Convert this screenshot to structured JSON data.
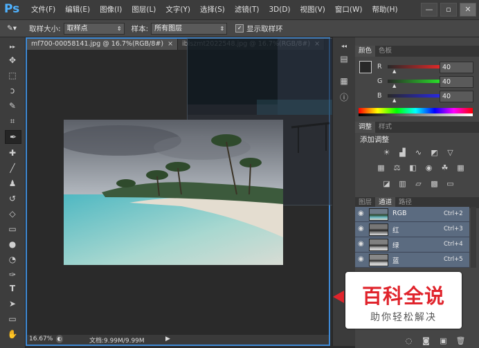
{
  "app": {
    "logo": "Ps"
  },
  "menu": [
    "文件(F)",
    "编辑(E)",
    "图像(I)",
    "图层(L)",
    "文字(Y)",
    "选择(S)",
    "滤镜(T)",
    "3D(D)",
    "视图(V)",
    "窗口(W)",
    "帮助(H)"
  ],
  "window_controls": {
    "minimize": "—",
    "restore": "▫",
    "close": "✕"
  },
  "options": {
    "sample_size_label": "取样大小:",
    "sample_size_value": "取样点",
    "sample_label": "样本:",
    "sample_value": "所有图层",
    "show_ring_label": "显示取样环",
    "show_ring_checked": true
  },
  "tabs": [
    {
      "label": "mf700-00058141.jpg @ 16.7%(RGB/8#)",
      "close": "×"
    },
    {
      "label": "iblszmt2022548.jpg @ 16.7%(RGB/8#)",
      "close": "×"
    }
  ],
  "status": {
    "zoom": "16.67%",
    "doc": "文档:9.99M/9.99M",
    "next": "▶"
  },
  "color_panel": {
    "tabs": [
      "颜色",
      "色板"
    ],
    "channels": [
      {
        "label": "R",
        "value": "40"
      },
      {
        "label": "G",
        "value": "40"
      },
      {
        "label": "B",
        "value": "40"
      }
    ],
    "fg_color": "#282828",
    "bg_color": "#ffffff"
  },
  "adjust_panel": {
    "tabs": [
      "调整",
      "样式"
    ],
    "title": "添加调整"
  },
  "channels_panel": {
    "tabs": [
      "图层",
      "通道",
      "路径"
    ],
    "rows": [
      {
        "name": "RGB",
        "shortcut": "Ctrl+2"
      },
      {
        "name": "红",
        "shortcut": "Ctrl+3"
      },
      {
        "name": "绿",
        "shortcut": "Ctrl+4"
      },
      {
        "name": "蓝",
        "shortcut": "Ctrl+5"
      }
    ]
  },
  "watermark": {
    "title": "百科全说",
    "subtitle": "助你轻松解决"
  },
  "colors": {
    "accent": "#3f8ad6",
    "watermark_red": "#e0242c",
    "logo_blue": "#4fb2ff"
  }
}
